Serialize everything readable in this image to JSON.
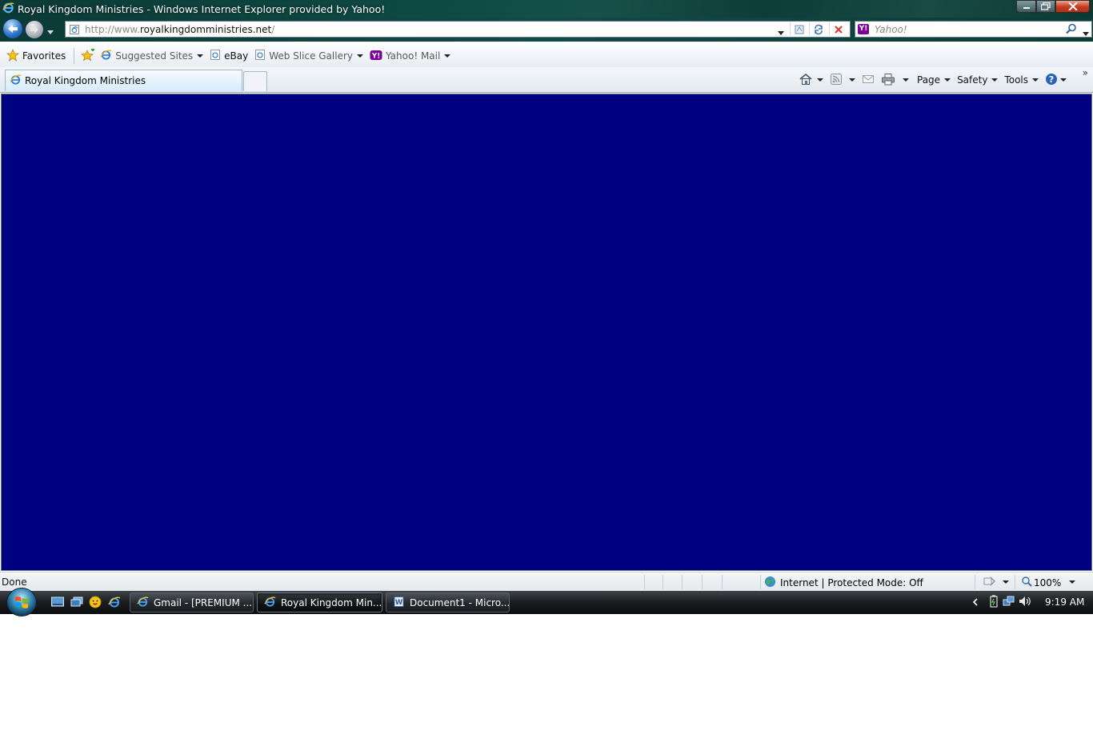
{
  "window": {
    "title": "Royal Kingdom Ministries - Windows Internet Explorer provided by Yahoo!"
  },
  "nav": {
    "address_prefix": "http://www.",
    "address_domain": "royalkingdomministries.net",
    "address_suffix": "/",
    "search_placeholder": "Yahoo!"
  },
  "favorites": {
    "favorites_label": "Favorites",
    "items": [
      {
        "label": "Suggested Sites",
        "icon": "ie-icon"
      },
      {
        "label": "eBay",
        "icon": "page-icon"
      },
      {
        "label": "Web Slice Gallery",
        "icon": "page-icon"
      },
      {
        "label": "Yahoo! Mail",
        "icon": "yahoo-icon"
      }
    ]
  },
  "tabs": {
    "active_label": "Royal Kingdom Ministries"
  },
  "commands": {
    "page_label": "Page",
    "safety_label": "Safety",
    "tools_label": "Tools",
    "more": "»"
  },
  "content": {
    "background": "#000080"
  },
  "status": {
    "text": "Done",
    "zone": "Internet | Protected Mode: Off",
    "zoom": "100%"
  },
  "taskbar": {
    "buttons": [
      {
        "label": "Gmail - [PREMIUM ..."
      },
      {
        "label": "Royal Kingdom Min..."
      },
      {
        "label": "Document1 - Micro..."
      }
    ],
    "clock": "9:19 AM"
  }
}
